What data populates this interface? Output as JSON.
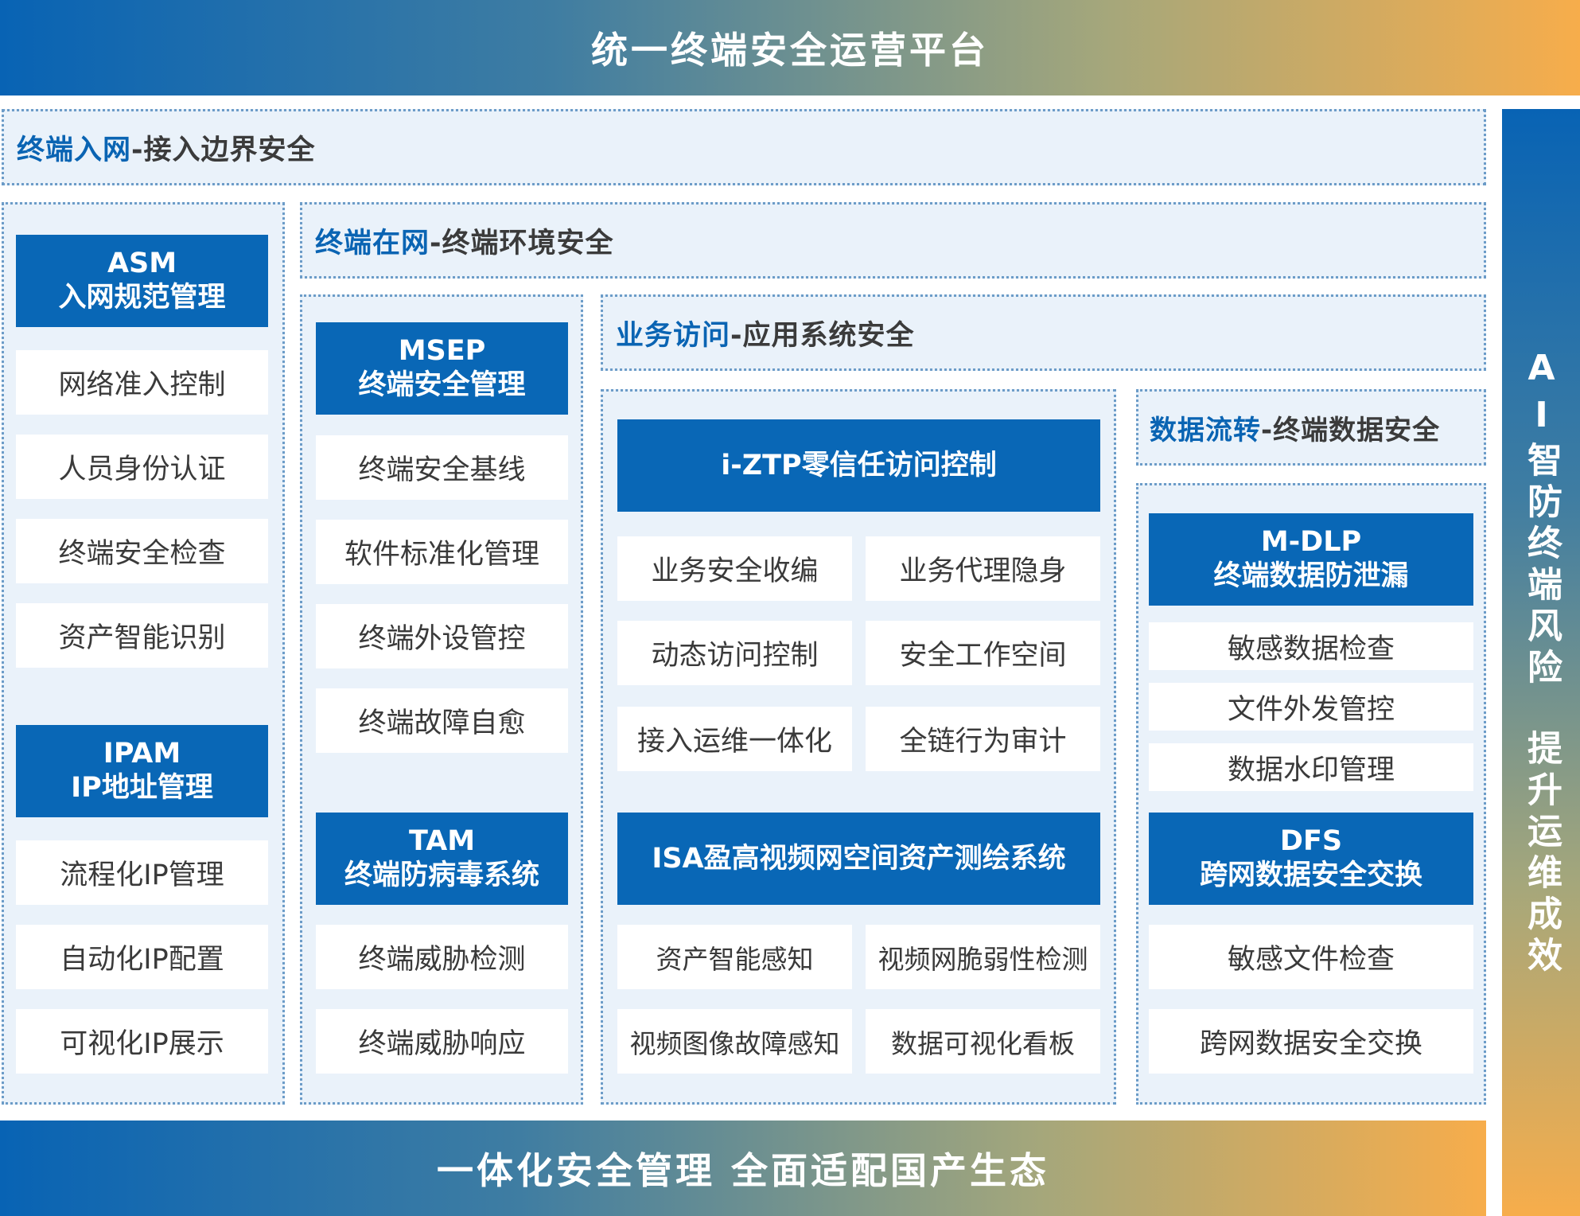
{
  "top_banner": "统一终端安全运营平台",
  "bottom_banner": "一体化安全管理 全面适配国产生态",
  "side_banner": {
    "part1": "AI智防终端风险",
    "part2": "提升运维成效"
  },
  "layers": {
    "access": {
      "highlight": "终端入网",
      "rest": "-接入边界安全"
    },
    "env": {
      "highlight": "终端在网",
      "rest": "-终端环境安全"
    },
    "app": {
      "highlight": "业务访问",
      "rest": "-应用系统安全"
    },
    "data": {
      "highlight": "数据流转",
      "rest": "-终端数据安全"
    }
  },
  "asm": {
    "line1": "ASM",
    "line2": "入网规范管理",
    "items": [
      "网络准入控制",
      "人员身份认证",
      "终端安全检查",
      "资产智能识别"
    ]
  },
  "ipam": {
    "line1": "IPAM",
    "line2": "IP地址管理",
    "items": [
      "流程化IP管理",
      "自动化IP配置",
      "可视化IP展示"
    ]
  },
  "msep": {
    "line1": "MSEP",
    "line2": "终端安全管理",
    "items": [
      "终端安全基线",
      "软件标准化管理",
      "终端外设管控",
      "终端故障自愈"
    ]
  },
  "tam": {
    "line1": "TAM",
    "line2": "终端防病毒系统",
    "items": [
      "终端威胁检测",
      "终端威胁响应"
    ]
  },
  "iztp": {
    "title": "i-ZTP零信任访问控制",
    "items": [
      "业务安全收编",
      "业务代理隐身",
      "动态访问控制",
      "安全工作空间",
      "接入运维一体化",
      "全链行为审计"
    ]
  },
  "isa": {
    "title": "ISA盈高视频网空间资产测绘系统",
    "items": [
      "资产智能感知",
      "视频网脆弱性检测",
      "视频图像故障感知",
      "数据可视化看板"
    ]
  },
  "mdlp": {
    "line1": "M-DLP",
    "line2": "终端数据防泄漏",
    "items": [
      "敏感数据检查",
      "文件外发管控",
      "数据水印管理"
    ]
  },
  "dfs": {
    "line1": "DFS",
    "line2": "跨网数据安全交换",
    "items": [
      "敏感文件检查",
      "跨网数据安全交换"
    ]
  }
}
